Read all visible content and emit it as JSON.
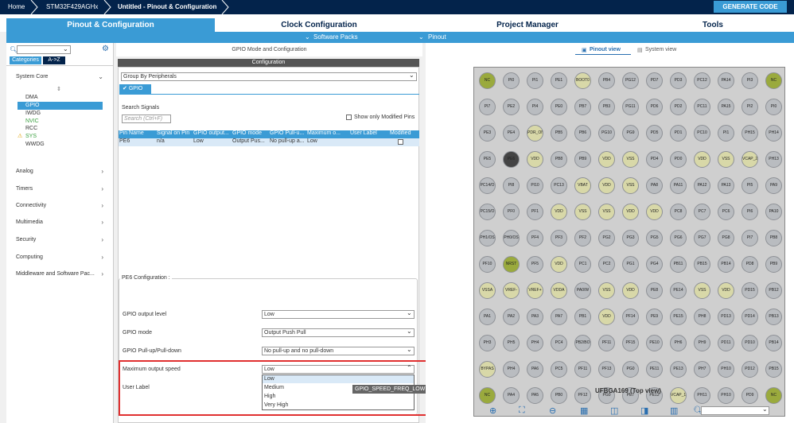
{
  "breadcrumbs": [
    "Home",
    "STM32F429AGHx",
    "Untitled - Pinout & Configuration"
  ],
  "generate_label": "GENERATE CODE",
  "tabs": [
    "Pinout & Configuration",
    "Clock Configuration",
    "Project Manager",
    "Tools"
  ],
  "subtabs": [
    "Software Packs",
    "Pinout"
  ],
  "sidebar": {
    "search_placeholder": "",
    "view_tabs": [
      "Categories",
      "A->Z"
    ],
    "system_core": "System Core",
    "system_items": [
      "DMA",
      "GPIO",
      "IWDG",
      "NVIC",
      "RCC",
      "SYS",
      "WWDG"
    ],
    "categories": [
      "Analog",
      "Timers",
      "Connectivity",
      "Multimedia",
      "Security",
      "Computing",
      "Middleware and Software Pac..."
    ]
  },
  "mode_panel": {
    "title": "GPIO Mode and Configuration",
    "config_label": "Configuration",
    "group_by": "Group By Peripherals",
    "gpio_tab": "GPIO",
    "search_label": "Search Signals",
    "search_placeholder": "Search (Ctrl+F)",
    "show_modified": "Show only Modified Pins",
    "columns": [
      "Pin Name",
      "Signal on Pin",
      "GPIO output...",
      "GPIO mode",
      "GPIO Pull-u...",
      "Maximum o...",
      "User Label",
      "Modified"
    ],
    "row": [
      "PE6",
      "n/a",
      "Low",
      "Output Pus...",
      "No pull-up a...",
      "Low",
      "",
      ""
    ],
    "pe6_config": "PE6 Configuration :",
    "fields": [
      {
        "label": "GPIO output level",
        "value": "Low"
      },
      {
        "label": "GPIO mode",
        "value": "Output Push Pull"
      },
      {
        "label": "GPIO Pull-up/Pull-down",
        "value": "No pull-up and no pull-down"
      },
      {
        "label": "Maximum output speed",
        "value": "Low"
      }
    ],
    "user_label": "User Label",
    "dropdown_options": [
      "Low",
      "Medium",
      "High",
      "Very High"
    ],
    "tooltip": "GPIO_SPEED_FREQ_LOW"
  },
  "pinout": {
    "view_tabs": [
      "Pinout view",
      "System view"
    ],
    "package_label": "UFBGA169 (Top view)",
    "rows": [
      [
        "NC",
        "PI0",
        "PI1",
        "PE1",
        "BOOT0",
        "PB4",
        "PG12",
        "PD7",
        "PD3",
        "PC12",
        "PA14",
        "PI3",
        "NC"
      ],
      [
        "PI7",
        "PE2",
        "PI4",
        "PE0",
        "PB7",
        "PB3",
        "PG11",
        "PD6",
        "PD2",
        "PC11",
        "PA15",
        "PI2",
        "PI0"
      ],
      [
        "PE3",
        "PE4",
        "PDR_ON",
        "PB5",
        "PB6",
        "PG10",
        "PG9",
        "PD5",
        "PD1",
        "PC10",
        "PI1",
        "PH15",
        "PH14"
      ],
      [
        "PE5",
        "PE6",
        "VDD",
        "PB8",
        "PB9",
        "VDD",
        "VSS",
        "PD4",
        "PD0",
        "VDD",
        "VSS",
        "VCAP_2",
        "PH13"
      ],
      [
        "PC14/O",
        "PI8",
        "PI10",
        "PC13",
        "VBAT",
        "VDD",
        "VSS",
        "PA8",
        "PA11",
        "PA12",
        "PA13",
        "PI5",
        "PA9"
      ],
      [
        "PC15/O",
        "PF0",
        "PF1",
        "VDD",
        "VSS",
        "VSS",
        "VDD",
        "VDD",
        "PC8",
        "PC7",
        "PC6",
        "PI6",
        "PA10"
      ],
      [
        "PH1/OS",
        "PH0/OS",
        "PF4",
        "PF3",
        "PF2",
        "PG2",
        "PG3",
        "PG5",
        "PG6",
        "PG7",
        "PG8",
        "PI7",
        "PB8"
      ],
      [
        "PF10",
        "NRST",
        "PF5",
        "VDD",
        "PC1",
        "PC2",
        "PG1",
        "PG4",
        "PB11",
        "PB15",
        "PB14",
        "PD8",
        "PB9"
      ],
      [
        "VSSA",
        "VREF-",
        "VREF+",
        "VDDA",
        "PA0/W",
        "VSS",
        "VDD",
        "PE8",
        "PE14",
        "VSS",
        "VDD",
        "PD15",
        "PB12"
      ],
      [
        "PA1",
        "PA2",
        "PA3",
        "PA7",
        "PB1",
        "VDD",
        "PF14",
        "PE9",
        "PE15",
        "PH8",
        "PD13",
        "PD14",
        "PB13"
      ],
      [
        "PH3",
        "PH5",
        "PH4",
        "PC4",
        "PB2/BO",
        "PF11",
        "PF15",
        "PE10",
        "PH6",
        "PH9",
        "PD11",
        "PD10",
        "PB14"
      ],
      [
        "BYPAS",
        "PH4",
        "PA6",
        "PC5",
        "PF11",
        "PF13",
        "PG0",
        "PE11",
        "PE13",
        "PH7",
        "PH10",
        "PD12",
        "PB15"
      ],
      [
        "NC",
        "PA4",
        "PA5",
        "PB0",
        "PF12",
        "PG0",
        "PE7",
        "PE12",
        "VCAP_1",
        "PH11",
        "PH10",
        "PD9",
        "NC"
      ]
    ]
  },
  "colors": {
    "navy": "#03234b",
    "accent": "#3a9bd5",
    "highlight": "#e03030"
  }
}
